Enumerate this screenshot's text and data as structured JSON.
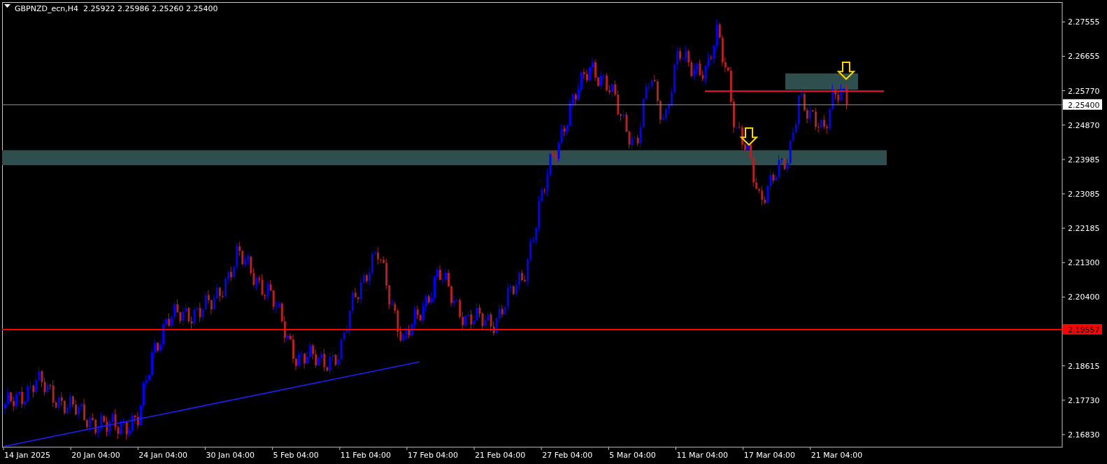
{
  "title": {
    "symbol": "GBPNZD_ecn,H4",
    "quote": "2.25922 2.25986 2.25260 2.25400"
  },
  "price_axis": {
    "labels": [
      "2.27555",
      "2.26655",
      "2.25770",
      "2.24870",
      "2.23985",
      "2.23085",
      "2.22185",
      "2.21300",
      "2.20400",
      "2.18615",
      "2.17730",
      "2.16830"
    ],
    "markers": [
      {
        "label": "2.25400",
        "kind": "current"
      },
      {
        "label": "2.19557",
        "kind": "level"
      }
    ]
  },
  "time_axis": {
    "labels": [
      "14 Jan 2025",
      "20 Jan 04:00",
      "24 Jan 04:00",
      "30 Jan 04:00",
      "5 Feb 04:00",
      "11 Feb 04:00",
      "17 Feb 04:00",
      "21 Feb 04:00",
      "27 Feb 04:00",
      "5 Mar 04:00",
      "11 Mar 04:00",
      "17 Mar 04:00",
      "21 Mar 04:00"
    ]
  }
}
